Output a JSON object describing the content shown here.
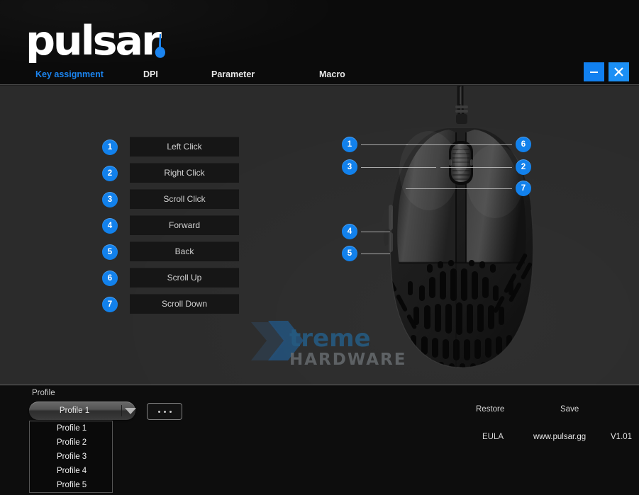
{
  "window": {
    "app_title": "pulsar",
    "minimize_icon": "minimize-icon",
    "close_icon": "close-icon"
  },
  "nav": {
    "tabs": [
      {
        "label": "Key assignment",
        "active": true
      },
      {
        "label": "DPI",
        "active": false
      },
      {
        "label": "Parameter",
        "active": false
      },
      {
        "label": "Macro",
        "active": false
      }
    ]
  },
  "key_assignment": {
    "rows": [
      {
        "number": "1",
        "label": "Left Click"
      },
      {
        "number": "2",
        "label": "Right Click"
      },
      {
        "number": "3",
        "label": "Scroll Click"
      },
      {
        "number": "4",
        "label": "Forward"
      },
      {
        "number": "5",
        "label": "Back"
      },
      {
        "number": "6",
        "label": "Scroll Up"
      },
      {
        "number": "7",
        "label": "Scroll Down"
      }
    ]
  },
  "device_diagram": {
    "image_name": "gaming-mouse-top-view",
    "callouts": [
      {
        "number": "1",
        "side": "left"
      },
      {
        "number": "3",
        "side": "left"
      },
      {
        "number": "4",
        "side": "left"
      },
      {
        "number": "5",
        "side": "left"
      },
      {
        "number": "6",
        "side": "right"
      },
      {
        "number": "2",
        "side": "right"
      },
      {
        "number": "7",
        "side": "right"
      }
    ]
  },
  "watermark": {
    "line1": "Xtreme",
    "line2": "HARDWARE"
  },
  "footer": {
    "profile_label": "Profile",
    "selected_profile": "Profile 1",
    "more_button": "...",
    "profile_options": [
      "Profile 1",
      "Profile 2",
      "Profile 3",
      "Profile 4",
      "Profile 5"
    ],
    "restore_label": "Restore",
    "save_label": "Save",
    "eula_label": "EULA",
    "website": "www.pulsar.gg",
    "version": "V1.01"
  },
  "colors": {
    "accent_blue": "#1281ec",
    "close_blue": "#1b8ff5",
    "header_bg": "#0b0b0b",
    "body_bg": "#2b2b2b",
    "footer_bg": "#0d0d0d",
    "button_bg": "#161616"
  }
}
